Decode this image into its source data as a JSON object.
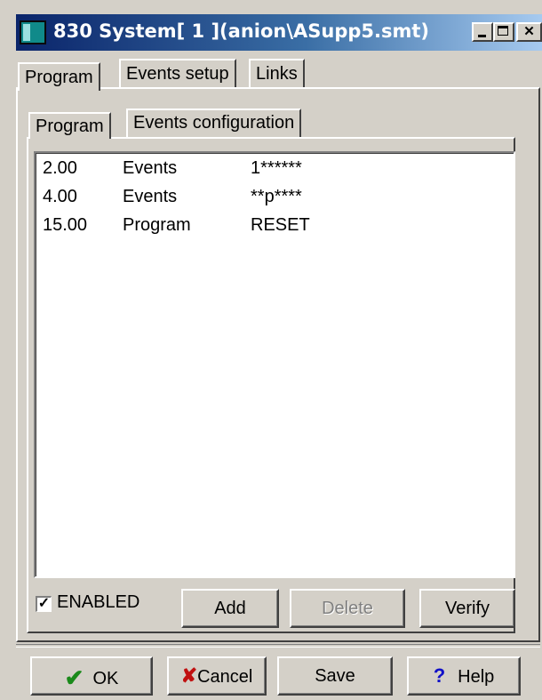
{
  "window": {
    "title": "830 System[ 1 ](anion\\ASupp5.smt)",
    "icon": "app-icon",
    "controls": {
      "minimize": "minimize-icon",
      "maximize": "maximize-icon",
      "close": "✕"
    }
  },
  "tabs": [
    {
      "label": "Program",
      "active": true
    },
    {
      "label": "Events setup",
      "active": false
    },
    {
      "label": "Links",
      "active": false
    }
  ],
  "subtabs": [
    {
      "label": "Program",
      "active": true
    },
    {
      "label": "Events configuration",
      "active": false
    }
  ],
  "program_list": {
    "rows": [
      {
        "time": "2.00",
        "type": "Events",
        "value": "1******"
      },
      {
        "time": "4.00",
        "type": "Events",
        "value": "**p****"
      },
      {
        "time": "15.00",
        "type": "Program",
        "value": "RESET"
      }
    ]
  },
  "controls": {
    "enabled_label": "ENABLED",
    "enabled_checked": true,
    "add_label": "Add",
    "delete_label": "Delete",
    "verify_label": "Verify"
  },
  "footer": {
    "ok_label": "OK",
    "cancel_label": "Cancel",
    "save_label": "Save",
    "help_label": "Help"
  },
  "colors": {
    "title_gradient_start": "#0a246a",
    "title_gradient_end": "#a6caf0",
    "face": "#d4d0c8"
  }
}
